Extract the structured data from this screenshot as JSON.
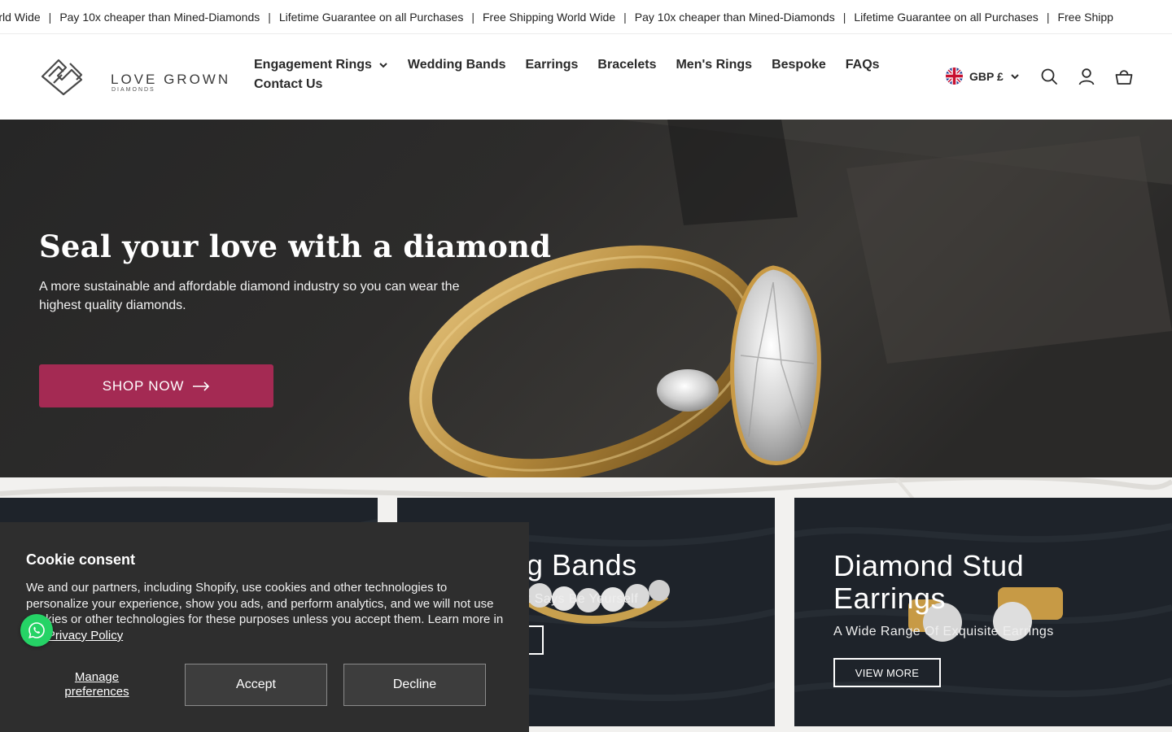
{
  "announcement": {
    "items": [
      "ing World Wide",
      "Pay 10x cheaper than Mined-Diamonds",
      "Lifetime Guarantee on all Purchases",
      "Free Shipping World Wide",
      "Pay 10x cheaper than Mined-Diamonds",
      "Lifetime Guarantee on all Purchases",
      "Free Shipp"
    ],
    "separator": "|"
  },
  "brand": {
    "name": "LOVE GROWN",
    "sub": "DIAMONDS"
  },
  "nav": {
    "engagement_rings": "Engagement Rings",
    "wedding_bands": "Wedding Bands",
    "earrings": "Earrings",
    "bracelets": "Bracelets",
    "mens_rings": "Men's Rings",
    "bespoke": "Bespoke",
    "faqs": "FAQs",
    "contact_us": "Contact Us"
  },
  "header": {
    "currency": "GBP £",
    "icons": [
      "search-icon",
      "account-icon",
      "cart-icon"
    ]
  },
  "hero": {
    "title": "Seal your love with a diamond",
    "subtitle": "A more sustainable and affordable diamond industry so you can wear the highest quality diamonds.",
    "cta": "SHOP NOW",
    "cta_color": "#a42a53"
  },
  "cards": {
    "wedding_bands": {
      "title": "ing Bands",
      "subtitle": "t Says Be Yourself"
    },
    "earrings": {
      "title": "Diamond Stud Earrings",
      "subtitle": "A Wide Range Of Exquisite Earrings",
      "cta": "VIEW MORE"
    }
  },
  "cookie": {
    "title": "Cookie consent",
    "text": "We and our partners, including Shopify, use cookies and other technologies to personalize your experience, show you ads, and perform analytics, and we will not use cookies or other technologies for these purposes unless you accept them. Learn more in our",
    "link": "Privacy Policy",
    "manage": "Manage preferences",
    "accept": "Accept",
    "decline": "Decline"
  },
  "colors": {
    "accent": "#a42a53",
    "whatsapp": "#25d366",
    "cookie_bg": "#2e2e2e"
  }
}
